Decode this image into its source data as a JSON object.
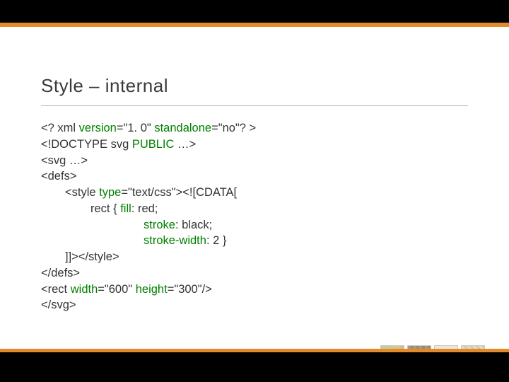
{
  "title": "Style – internal",
  "code": {
    "l1a": "<? xml ",
    "l1b": "version",
    "l1c": "=\"1. 0\" ",
    "l1d": "standalone",
    "l1e": "=\"no\"? >",
    "l2a": "<!DOCTYPE svg ",
    "l2b": "PUBLIC",
    "l2c": " …>",
    "l3": "<svg …>",
    "l4": "<defs>",
    "l5a": "<style ",
    "l5b": "type",
    "l5c": "=\"text/css\"><![CDATA[",
    "l6a": "rect { ",
    "l6b": "fill",
    "l6c": ": red;",
    "l7a": "stroke",
    "l7b": ": black;",
    "l8a": "stroke-width",
    "l8b": ": 2 }",
    "l9": "]]></style>",
    "l10": "</defs>",
    "l11a": "<rect ",
    "l11b": "width",
    "l11c": "=\"600\" ",
    "l11d": "height",
    "l11e": "=\"300\"/>",
    "l12": "</svg>"
  }
}
